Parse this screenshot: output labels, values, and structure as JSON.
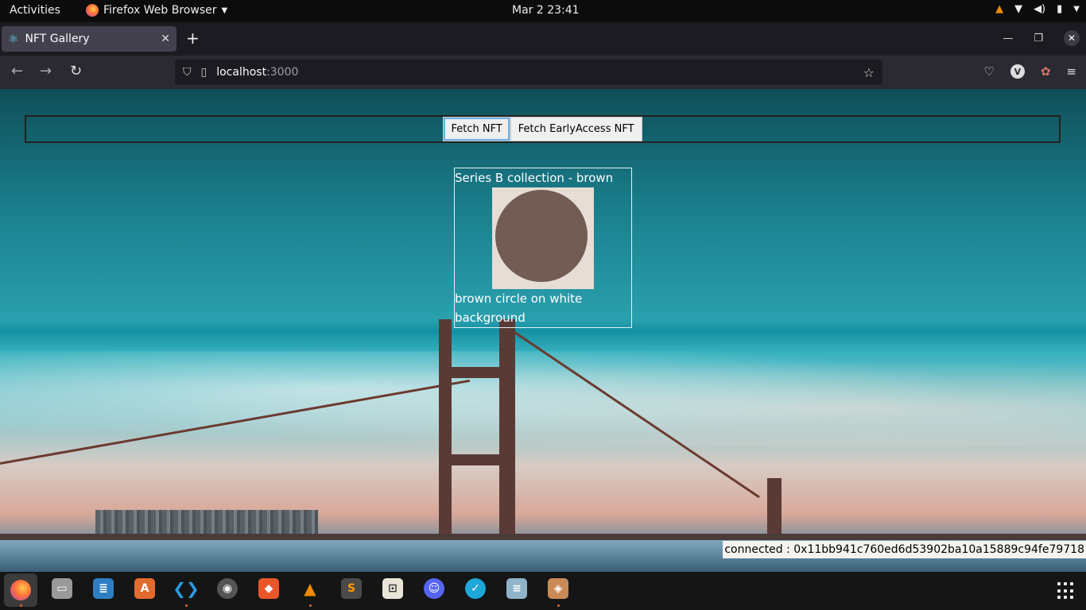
{
  "topbar": {
    "activities": "Activities",
    "app_name": "Firefox Web Browser",
    "clock": "Mar 2  23:41"
  },
  "browser": {
    "tab_title": "NFT Gallery",
    "url_host": "localhost",
    "url_port": ":3000"
  },
  "page": {
    "buttons": {
      "fetch_nft": "Fetch NFT",
      "fetch_early": "Fetch EarlyAccess NFT"
    },
    "nft_card": {
      "title": "Series B collection - brown",
      "description": "brown circle on white background",
      "image_icon": "brown-circle",
      "circle_color": "#725c54",
      "image_bg_color": "#e5ddd6"
    },
    "status": "connected : 0x11bb941c760ed6d53902ba10a15889c94fe79718"
  },
  "dock": {
    "apps": [
      "firefox",
      "files",
      "libreoffice-writer",
      "app-center",
      "vscode",
      "rhythmbox",
      "brave",
      "vlc",
      "sublime-text",
      "screenshot",
      "discord",
      "tasks",
      "text-editor",
      "package"
    ]
  }
}
